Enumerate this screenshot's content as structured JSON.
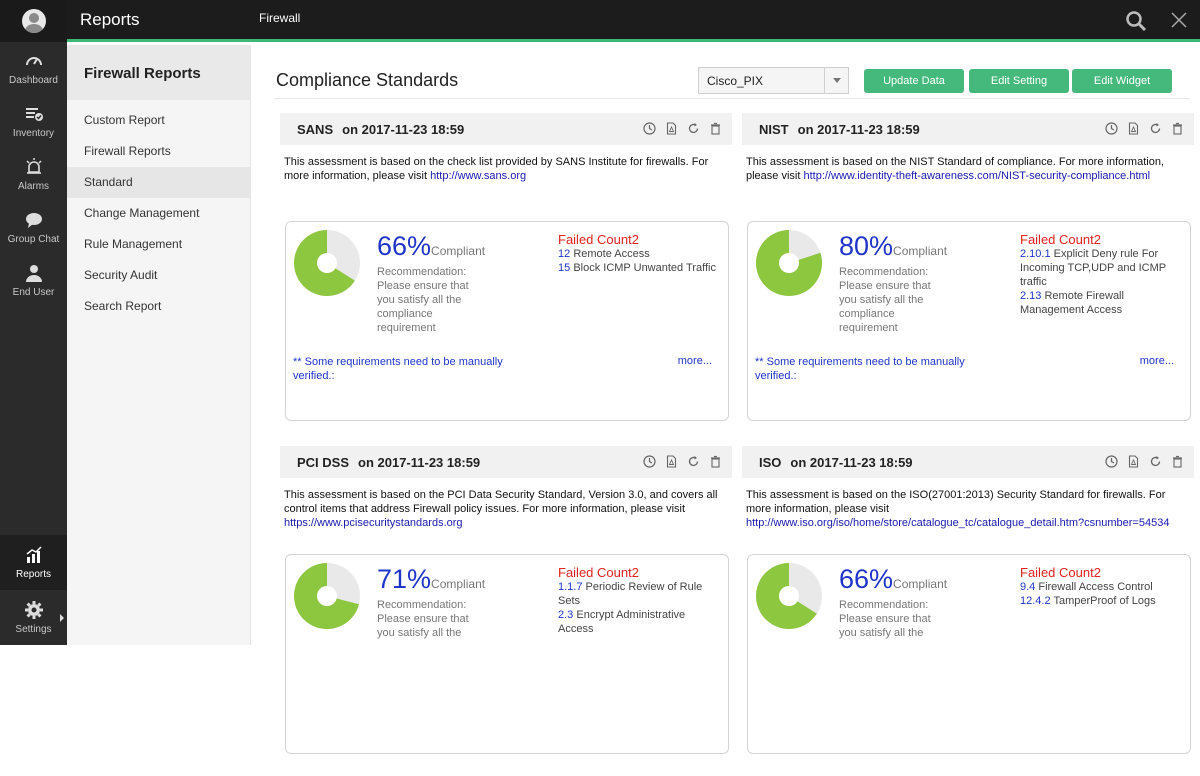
{
  "app": {
    "title": "Reports",
    "module": "Firewall"
  },
  "rail": {
    "items": [
      {
        "label": "Dashboard",
        "icon": "gauge-icon"
      },
      {
        "label": "Inventory",
        "icon": "inventory-icon"
      },
      {
        "label": "Alarms",
        "icon": "alarm-icon"
      },
      {
        "label": "Group Chat",
        "icon": "chat-icon"
      },
      {
        "label": "End User",
        "icon": "user-icon"
      }
    ],
    "bottom": [
      {
        "label": "Reports",
        "icon": "chart-icon"
      },
      {
        "label": "Settings",
        "icon": "gear-icon"
      }
    ]
  },
  "subnav": {
    "title": "Firewall Reports",
    "items": [
      "Custom Report",
      "Firewall Reports",
      "Standard",
      "Change Management",
      "Rule Management",
      "Security Audit",
      "Search Report"
    ],
    "active_index": 2
  },
  "main": {
    "title": "Compliance Standards",
    "device_select": {
      "value": "Cisco_PIX"
    },
    "buttons": {
      "update": "Update Data",
      "edit_setting": "Edit Setting",
      "edit_widget": "Edit Widget"
    }
  },
  "colors": {
    "accent": "#45b97c",
    "pie_fill": "#8dc63f",
    "pie_rest": "#e9e9e9",
    "percent": "#1f35c9",
    "failed": "#e0231e"
  },
  "widgets": [
    {
      "name": "SANS",
      "date": "on 2017-11-23 18:59",
      "desc": "This assessment is based on the check list provided by SANS Institute for firewalls. For more information, please visit ",
      "link": "http://www.sans.org",
      "percent": "66%",
      "percent_value": 66,
      "compliant_label": "Compliant",
      "recommendation": "Recommendation: Please ensure that you satisfy all the compliance requirement",
      "failed_title": "Failed Count2",
      "failed_items": [
        {
          "code": "12",
          "text": "Remote Access"
        },
        {
          "code": "15",
          "text": "Block ICMP Unwanted Traffic"
        }
      ],
      "manual_note": "** Some requirements need to be manually verified.:",
      "more": "more..."
    },
    {
      "name": "NIST",
      "date": "on 2017-11-23 18:59",
      "desc": "This assessment is based on the NIST Standard of compliance. For more information, please visit ",
      "link": "http://www.identity-theft-awareness.com/NIST-security-compliance.html",
      "percent": "80%",
      "percent_value": 80,
      "compliant_label": "Compliant",
      "recommendation": "Recommendation: Please ensure that you satisfy all the compliance requirement",
      "failed_title": "Failed Count2",
      "failed_items": [
        {
          "code": "2.10.1",
          "text": "Explicit Deny rule For Incoming TCP,UDP and ICMP traffic"
        },
        {
          "code": "2.13",
          "text": "Remote Firewall Management Access"
        }
      ],
      "manual_note": "** Some requirements need to be manually verified.:",
      "more": "more..."
    },
    {
      "name": "PCI DSS",
      "date": "on 2017-11-23 18:59",
      "desc": "This assessment is based on the PCI Data Security Standard, Version 3.0, and covers all control items that address Firewall policy issues. For more information, please visit ",
      "link": "https://www.pcisecuritystandards.org",
      "percent": "71%",
      "percent_value": 71,
      "compliant_label": "Compliant",
      "recommendation": "Recommendation: Please ensure that you satisfy all the",
      "failed_title": "Failed Count2",
      "failed_items": [
        {
          "code": "1.1.7",
          "text": "Periodic Review of Rule Sets"
        },
        {
          "code": "2.3",
          "text": "Encrypt Administrative Access"
        }
      ],
      "manual_note": "",
      "more": ""
    },
    {
      "name": "ISO",
      "date": "on 2017-11-23 18:59",
      "desc": "This assessment is based on the ISO(27001:2013) Security Standard for firewalls. For more information, please visit ",
      "link": "http://www.iso.org/iso/home/store/catalogue_tc/catalogue_detail.htm?csnumber=54534",
      "percent": "66%",
      "percent_value": 66,
      "compliant_label": "Compliant",
      "recommendation": "Recommendation: Please ensure that you satisfy all the",
      "failed_title": "Failed Count2",
      "failed_items": [
        {
          "code": "9.4",
          "text": "Firewall Access Control"
        },
        {
          "code": "12.4.2",
          "text": "TamperProof of Logs"
        }
      ],
      "manual_note": "",
      "more": ""
    }
  ]
}
